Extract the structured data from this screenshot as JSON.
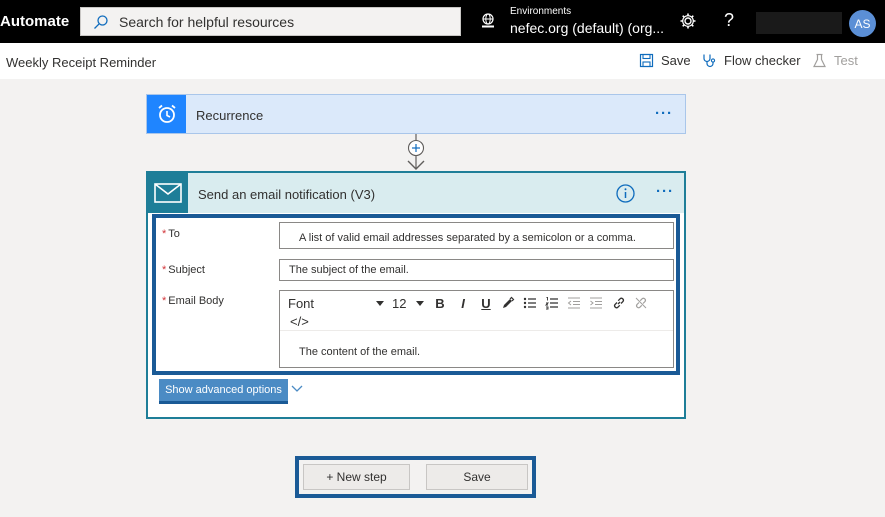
{
  "topbar": {
    "app_name": "Automate",
    "search_placeholder": "Search for helpful resources",
    "env_label": "Environments",
    "env_value": "nefec.org (default) (org...",
    "help": "?",
    "avatar_initials": "AS"
  },
  "subheader": {
    "flow_title": "Weekly Receipt Reminder",
    "save_label": "Save",
    "checker_label": "Flow checker",
    "test_label": "Test"
  },
  "recurrence": {
    "title": "Recurrence",
    "dots": "···"
  },
  "email": {
    "title": "Send an email notification (V3)",
    "dots": "···",
    "to_label": "To",
    "to_placeholder": "A list of valid email addresses separated by a semicolon or a comma.",
    "subject_label": "Subject",
    "subject_placeholder": "The subject of the email.",
    "body_label": "Email Body",
    "font_value": "Font",
    "size_value": "12",
    "bold": "B",
    "italic": "I",
    "underline": "U",
    "code_label": "</>",
    "body_placeholder": "The content of the email.",
    "advanced_label": "Show advanced options"
  },
  "footer": {
    "new_step": "+ New step",
    "save": "Save"
  },
  "colors": {
    "accent": "#1e7e98",
    "recurrence_blue": "#1f85ff",
    "highlight_border": "#1a5a96"
  }
}
